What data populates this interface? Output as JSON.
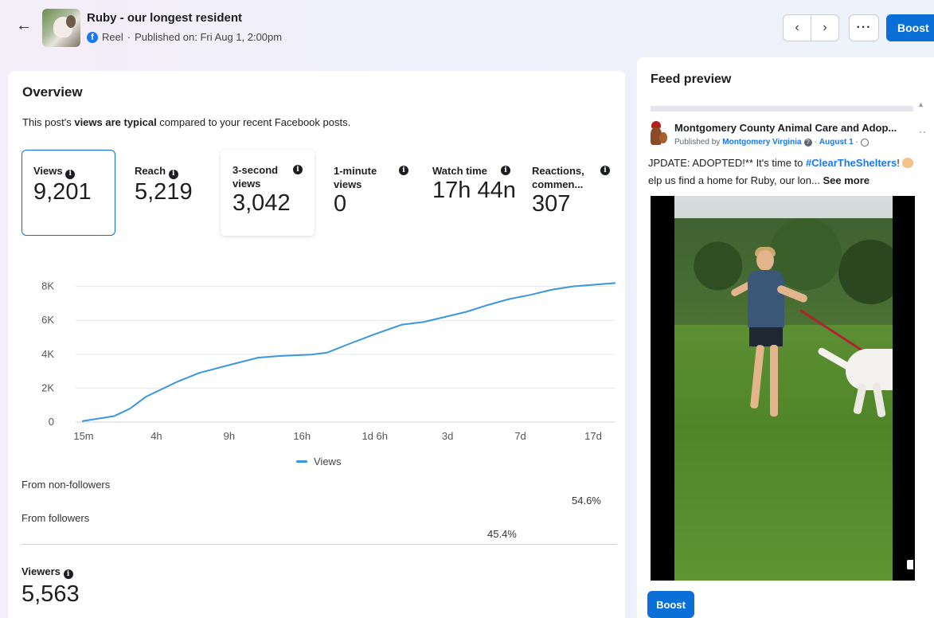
{
  "header": {
    "title": "Ruby - our longest resident",
    "post_type": "Reel",
    "published": "Published on: Fri Aug 1, 2:00pm",
    "boost_label": "Boost"
  },
  "overview": {
    "title": "Overview",
    "desc_prefix": "This post's ",
    "desc_bold": "views are typical",
    "desc_suffix": " compared to your recent Facebook posts.",
    "metrics": [
      {
        "label": "Views",
        "value": "9,201"
      },
      {
        "label": "Reach",
        "value": "5,219"
      },
      {
        "label": "3-second views",
        "value": "3,042"
      },
      {
        "label": "1-minute views",
        "value": "0"
      },
      {
        "label": "Watch time",
        "value": "17h 44n"
      },
      {
        "label": "Reactions, commen...",
        "value": "307"
      }
    ],
    "legend": "Views",
    "sources": [
      {
        "label": "From non-followers",
        "pct": "54.6%",
        "fraction": 0.546
      },
      {
        "label": "From followers",
        "pct": "45.4%",
        "fraction": 0.454
      }
    ],
    "viewers_label": "Viewers",
    "viewers_value": "5,563"
  },
  "chart_data": {
    "type": "line",
    "series": [
      {
        "name": "Views"
      }
    ],
    "x": [
      "15m",
      "4h",
      "9h",
      "16h",
      "1d 6h",
      "3d",
      "7d",
      "17d"
    ],
    "y_ticks": [
      "0",
      "2K",
      "4K",
      "6K",
      "8K"
    ],
    "ylim": [
      0,
      8500
    ],
    "points": [
      [
        0.0,
        50
      ],
      [
        0.06,
        350
      ],
      [
        0.09,
        800
      ],
      [
        0.12,
        1500
      ],
      [
        0.18,
        2400
      ],
      [
        0.22,
        2900
      ],
      [
        0.28,
        3400
      ],
      [
        0.33,
        3800
      ],
      [
        0.37,
        3900
      ],
      [
        0.43,
        3980
      ],
      [
        0.46,
        4100
      ],
      [
        0.5,
        4600
      ],
      [
        0.55,
        5200
      ],
      [
        0.6,
        5750
      ],
      [
        0.64,
        5900
      ],
      [
        0.68,
        6200
      ],
      [
        0.72,
        6500
      ],
      [
        0.76,
        6900
      ],
      [
        0.8,
        7250
      ],
      [
        0.84,
        7500
      ],
      [
        0.88,
        7800
      ],
      [
        0.92,
        8000
      ],
      [
        0.96,
        8100
      ],
      [
        1.0,
        8200
      ]
    ],
    "legend_position": "bottom"
  },
  "feed_preview": {
    "title": "Feed preview",
    "page_name": "Montgomery County Animal Care and Adop...",
    "published_by_prefix": "Published by",
    "published_by_name": "Montgomery Virginia",
    "date": "August 1",
    "line1_text": "JPDATE: ADOPTED!** It's time to",
    "line1_tag": "#ClearTheShelters",
    "line1_suffix": "!",
    "line2_text": "elp us find a home for Ruby, our lon...",
    "see_more": "See more",
    "boost_label": "Boost"
  }
}
